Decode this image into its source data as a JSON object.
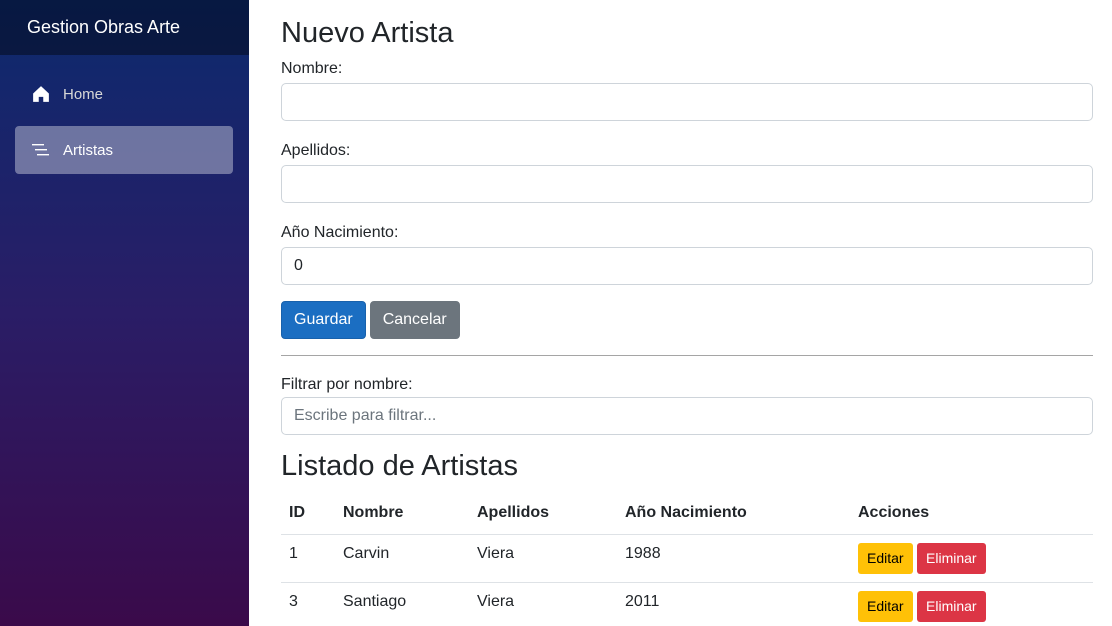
{
  "sidebar": {
    "brand": "Gestion Obras Arte",
    "items": [
      {
        "label": "Home",
        "icon": "home-icon",
        "active": false
      },
      {
        "label": "Artistas",
        "icon": "list-icon",
        "active": true
      }
    ]
  },
  "form": {
    "title": "Nuevo Artista",
    "nombre_label": "Nombre:",
    "nombre_value": "",
    "apellidos_label": "Apellidos:",
    "apellidos_value": "",
    "anio_label": "Año Nacimiento:",
    "anio_value": "0",
    "save_label": "Guardar",
    "cancel_label": "Cancelar"
  },
  "filter": {
    "label": "Filtrar por nombre:",
    "placeholder": "Escribe para filtrar..."
  },
  "list": {
    "title": "Listado de Artistas",
    "columns": [
      "ID",
      "Nombre",
      "Apellidos",
      "Año Nacimiento",
      "Acciones"
    ],
    "rows": [
      {
        "id": "1",
        "nombre": "Carvin",
        "apellidos": "Viera",
        "anio": "1988",
        "edit": "Editar",
        "delete": "Eliminar"
      },
      {
        "id": "3",
        "nombre": "Santiago",
        "apellidos": "Viera",
        "anio": "2011",
        "edit": "Editar",
        "delete": "Eliminar"
      }
    ]
  },
  "colors": {
    "primary": "#1b6ec2",
    "secondary": "#6c757d",
    "warning": "#ffc107",
    "danger": "#dc3545"
  }
}
